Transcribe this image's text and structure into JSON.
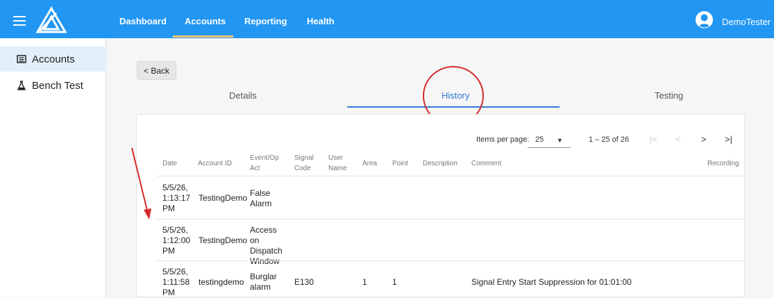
{
  "nav": {
    "items": [
      "Dashboard",
      "Accounts",
      "Reporting",
      "Health"
    ],
    "active": "Accounts",
    "user_name": "DemoTester"
  },
  "sidebar": {
    "items": [
      {
        "label": "Accounts",
        "icon": "list-icon",
        "active": true
      },
      {
        "label": "Bench Test",
        "icon": "flask-icon",
        "active": false
      }
    ]
  },
  "back_label": "< Back",
  "tabs": [
    {
      "label": "Details"
    },
    {
      "label": "History",
      "active": true
    },
    {
      "label": "Testing"
    }
  ],
  "pager": {
    "items_per_page_label": "Items per page:",
    "items_per_page_value": "25",
    "range_label": "1 – 25 of 26"
  },
  "table": {
    "columns": [
      "Date",
      "Account ID",
      "Event/Op Act",
      "Signal Code",
      "User Name",
      "Area",
      "Point",
      "Description",
      "Comment",
      "Recording"
    ],
    "rows": [
      {
        "date": "5/5/26, 1:13:17 PM",
        "account": "TestingDemo",
        "event": "False Alarm",
        "signal": "",
        "user": "",
        "area": "",
        "point": "",
        "description": "",
        "comment": ""
      },
      {
        "date": "5/5/26, 1:12:00 PM",
        "account": "TestingDemo",
        "event": "Access on Dispatch Window",
        "signal": "",
        "user": "",
        "area": "",
        "point": "",
        "description": "",
        "comment": ""
      },
      {
        "date": "5/5/26, 1:11:58 PM",
        "account": "testingdemo",
        "event": "Burglar alarm",
        "signal": "E130",
        "user": "",
        "area": "1",
        "point": "1",
        "description": "",
        "comment": "Signal Entry Start Suppression for 01:01:00"
      }
    ]
  },
  "colors": {
    "topbar": "#2196f3",
    "active_tab": "#2f7bd6",
    "annotation": "#d62a2a"
  }
}
